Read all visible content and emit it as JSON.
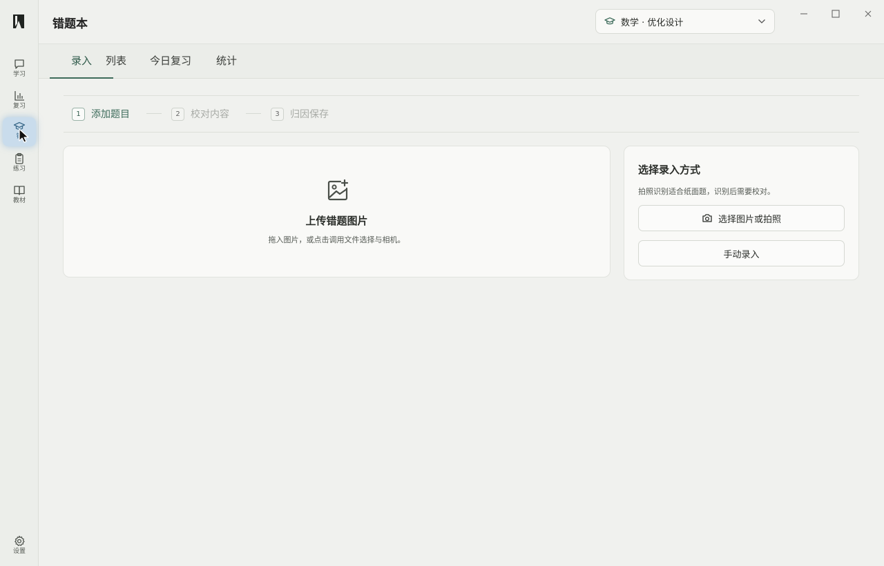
{
  "app": {
    "title": "错题本"
  },
  "subject": {
    "selected": "数学 · 优化设计"
  },
  "sidebar": {
    "items": [
      {
        "label": "学习",
        "icon": "chat-bubble-icon"
      },
      {
        "label": "复习",
        "icon": "bar-chart-icon"
      },
      {
        "label": "错",
        "icon": "graduation-cap-icon"
      },
      {
        "label": "练习",
        "icon": "clipboard-icon"
      },
      {
        "label": "教材",
        "icon": "book-icon"
      }
    ],
    "settings_label": "设置"
  },
  "tabs": [
    {
      "label": "录入"
    },
    {
      "label": "列表"
    },
    {
      "label": "今日复习"
    },
    {
      "label": "统计"
    }
  ],
  "steps": [
    {
      "num": "1",
      "label": "添加题目"
    },
    {
      "num": "2",
      "label": "校对内容"
    },
    {
      "num": "3",
      "label": "归因保存"
    }
  ],
  "upload": {
    "title": "上传错题图片",
    "desc": "拖入图片，或点击调用文件选择与相机。"
  },
  "method": {
    "title": "选择录入方式",
    "desc": "拍照识别适合纸面题，识别后需要校对。",
    "pick_button": "选择图片或拍照",
    "manual_button": "手动录入"
  },
  "colors": {
    "accent": "#3d6b5a",
    "active_nav": "#c9dcec",
    "background": "#f0f1ee",
    "card": "#f9f9f7"
  }
}
